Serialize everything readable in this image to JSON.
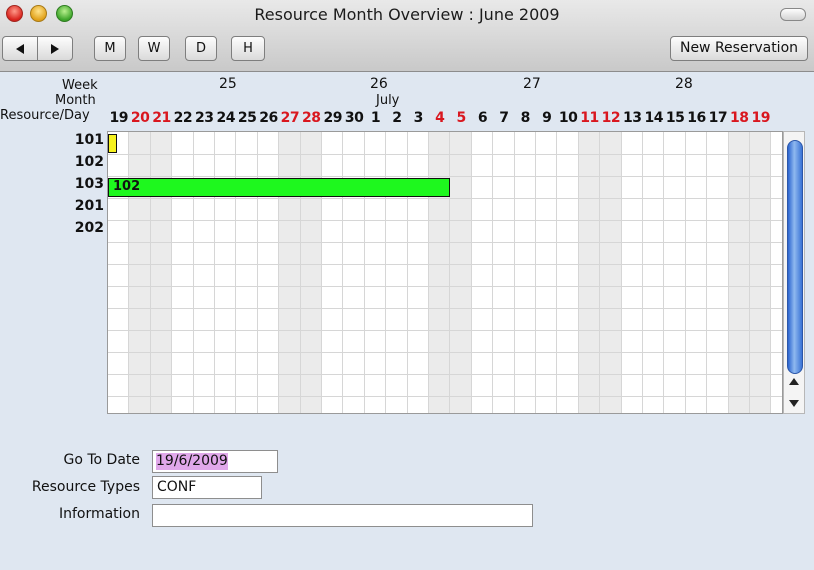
{
  "window": {
    "title": "Resource Month Overview : June 2009"
  },
  "toolbar": {
    "nav_back_icon": "arrow-left-icon",
    "nav_forward_icon": "arrow-right-icon",
    "view_month": "M",
    "view_week": "W",
    "view_day": "D",
    "view_hour": "H",
    "new_reservation": "New Reservation"
  },
  "header": {
    "week_label": "Week",
    "month_label": "Month",
    "resource_day_label": "Resource/Day",
    "weeks": [
      "25",
      "26",
      "27",
      "28"
    ],
    "month_name": "July",
    "days": [
      {
        "d": "19",
        "weekend": false
      },
      {
        "d": "20",
        "weekend": true
      },
      {
        "d": "21",
        "weekend": true
      },
      {
        "d": "22",
        "weekend": false
      },
      {
        "d": "23",
        "weekend": false
      },
      {
        "d": "24",
        "weekend": false
      },
      {
        "d": "25",
        "weekend": false
      },
      {
        "d": "26",
        "weekend": false
      },
      {
        "d": "27",
        "weekend": true
      },
      {
        "d": "28",
        "weekend": true
      },
      {
        "d": "29",
        "weekend": false
      },
      {
        "d": "30",
        "weekend": false
      },
      {
        "d": "1",
        "weekend": false
      },
      {
        "d": "2",
        "weekend": false
      },
      {
        "d": "3",
        "weekend": false
      },
      {
        "d": "4",
        "weekend": true
      },
      {
        "d": "5",
        "weekend": true
      },
      {
        "d": "6",
        "weekend": false
      },
      {
        "d": "7",
        "weekend": false
      },
      {
        "d": "8",
        "weekend": false
      },
      {
        "d": "9",
        "weekend": false
      },
      {
        "d": "10",
        "weekend": false
      },
      {
        "d": "11",
        "weekend": true
      },
      {
        "d": "12",
        "weekend": true
      },
      {
        "d": "13",
        "weekend": false
      },
      {
        "d": "14",
        "weekend": false
      },
      {
        "d": "15",
        "weekend": false
      },
      {
        "d": "16",
        "weekend": false
      },
      {
        "d": "17",
        "weekend": false
      },
      {
        "d": "18",
        "weekend": true
      },
      {
        "d": "19",
        "weekend": true
      }
    ]
  },
  "resources": [
    "101",
    "102",
    "103",
    "201",
    "202"
  ],
  "reservations": [
    {
      "resource_index": 0,
      "start_day_index": 0,
      "days": 0.4,
      "label": "",
      "color": "#f7f21f"
    },
    {
      "resource_index": 2,
      "start_day_index": 0,
      "days": 16,
      "label": "102",
      "color": "#1ef81e"
    }
  ],
  "form": {
    "goto_date_label": "Go To Date",
    "goto_date_value": "19/6/2009",
    "resource_types_label": "Resource Types",
    "resource_types_value": "CONF",
    "information_label": "Information",
    "information_value": ""
  },
  "colors": {
    "weekend_text": "#d9171f",
    "weekend_column": "#ebebeb",
    "scroll_thumb": "#3a74d6"
  }
}
